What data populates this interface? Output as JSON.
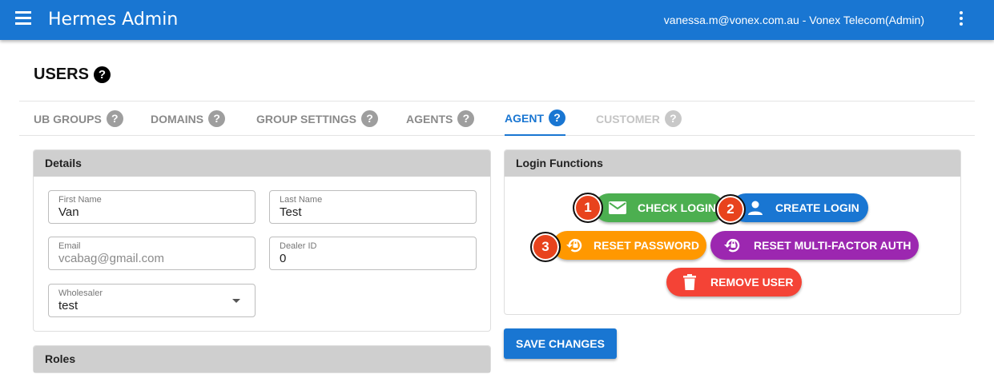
{
  "appbar": {
    "title": "Hermes Admin",
    "user": "vanessa.m@vonex.com.au - Vonex Telecom(Admin)",
    "menu_icon": "hamburger-menu-icon",
    "more_icon": "more-vert-icon"
  },
  "page": {
    "title": "USERS",
    "help": "?"
  },
  "tabs": [
    {
      "label": "UB GROUPS",
      "help": "?"
    },
    {
      "label": "DOMAINS",
      "help": "?"
    },
    {
      "label": "GROUP SETTINGS",
      "help": "?"
    },
    {
      "label": "AGENTS",
      "help": "?"
    },
    {
      "label": "AGENT",
      "help": "?",
      "active": true
    },
    {
      "label": "CUSTOMER",
      "help": "?",
      "disabled": true
    }
  ],
  "details": {
    "header": "Details",
    "first_name": {
      "label": "First Name",
      "value": "Van"
    },
    "last_name": {
      "label": "Last Name",
      "value": "Test"
    },
    "email": {
      "label": "Email",
      "value": "vcabag@gmail.com"
    },
    "dealer_id": {
      "label": "Dealer ID",
      "value": "0"
    },
    "wholesaler": {
      "label": "Wholesaler",
      "value": "test"
    }
  },
  "roles": {
    "header": "Roles"
  },
  "login_functions": {
    "header": "Login Functions",
    "check_login": "CHECK LOGIN",
    "create_login": "CREATE LOGIN",
    "reset_password": "RESET PASSWORD",
    "reset_mfa": "RESET MULTI-FACTOR AUTH",
    "remove_user": "REMOVE USER",
    "badges": [
      "1",
      "2",
      "3"
    ]
  },
  "save_label": "SAVE CHANGES",
  "colors": {
    "primary": "#1976d2",
    "check_login": "#4caf50",
    "create_login": "#1976d2",
    "reset_password": "#ff9800",
    "reset_mfa": "#9c27b0",
    "remove_user": "#f44336",
    "badge": "#e8431d"
  }
}
